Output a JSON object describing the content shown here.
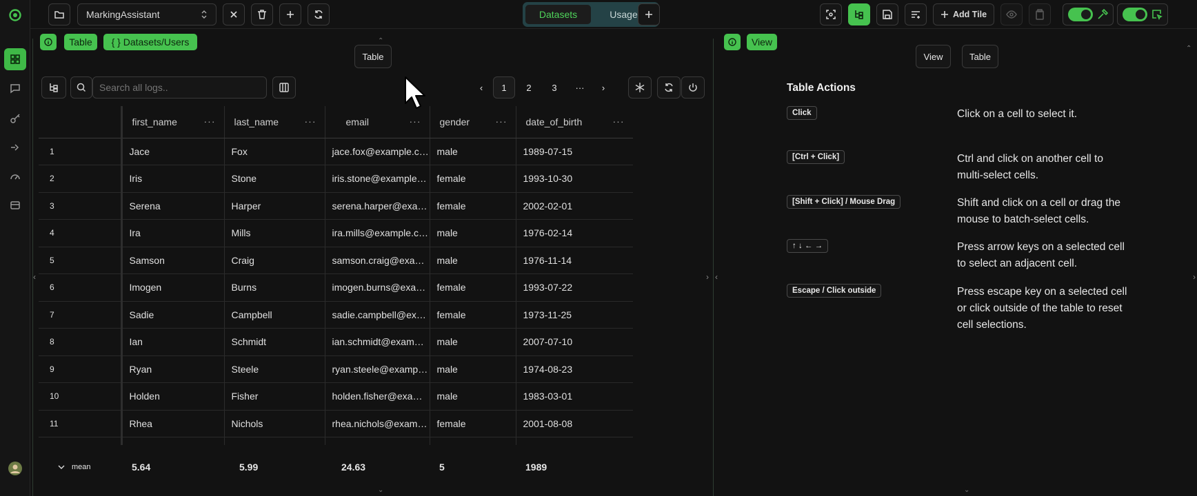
{
  "project": {
    "name": "MarkingAssistant"
  },
  "tabs": [
    "Datasets",
    "Usage"
  ],
  "toolbar": {
    "add_tile": "Add Tile"
  },
  "left_pane": {
    "chip": "Table",
    "path_chip": "{ } Datasets/Users",
    "view_pill": "Table"
  },
  "right_pane": {
    "chip": "View",
    "pills": [
      "View",
      "Table"
    ],
    "title": "Table Actions"
  },
  "search": {
    "placeholder": "Search all logs.."
  },
  "pagination": {
    "pages": [
      "1",
      "2",
      "3"
    ],
    "ellipsis": "···",
    "current": "1"
  },
  "table": {
    "columns": [
      "first_name",
      "last_name",
      "email",
      "gender",
      "date_of_birth"
    ],
    "rows": [
      [
        "1",
        "Jace",
        "Fox",
        "jace.fox@example.com",
        "male",
        "1989-07-15"
      ],
      [
        "2",
        "Iris",
        "Stone",
        "iris.stone@example.com",
        "female",
        "1993-10-30"
      ],
      [
        "3",
        "Serena",
        "Harper",
        "serena.harper@example.com",
        "female",
        "2002-02-01"
      ],
      [
        "4",
        "Ira",
        "Mills",
        "ira.mills@example.com",
        "male",
        "1976-02-14"
      ],
      [
        "5",
        "Samson",
        "Craig",
        "samson.craig@example.com",
        "male",
        "1976-11-14"
      ],
      [
        "6",
        "Imogen",
        "Burns",
        "imogen.burns@example.com",
        "female",
        "1993-07-22"
      ],
      [
        "7",
        "Sadie",
        "Campbell",
        "sadie.campbell@example.com",
        "female",
        "1973-11-25"
      ],
      [
        "8",
        "Ian",
        "Schmidt",
        "ian.schmidt@example.com",
        "male",
        "2007-07-10"
      ],
      [
        "9",
        "Ryan",
        "Steele",
        "ryan.steele@example.com",
        "male",
        "1974-08-23"
      ],
      [
        "10",
        "Holden",
        "Fisher",
        "holden.fisher@example.com",
        "male",
        "1983-03-01"
      ],
      [
        "11",
        "Rhea",
        "Nichols",
        "rhea.nichols@example.com",
        "female",
        "2001-08-08"
      ]
    ],
    "footer": {
      "label": "mean",
      "values": [
        "5.64",
        "5.99",
        "24.63",
        "5",
        "1989"
      ]
    }
  },
  "actions": [
    {
      "key": "Click",
      "description": "Click on a cell to select it."
    },
    {
      "key": "[Ctrl + Click]",
      "description": "Ctrl and click on another cell to multi-select cells."
    },
    {
      "key": "[Shift + Click] / Mouse Drag",
      "description": "Shift and click on a cell or drag the mouse to batch-select cells."
    },
    {
      "key": "↑ ↓ ← →",
      "description": "Press arrow keys on a selected cell to select an adjacent cell."
    },
    {
      "key": "Escape / Click outside",
      "description": "Press escape key on a selected cell or click outside of the table to reset cell selections."
    }
  ],
  "colors": {
    "accent": "#46c24f",
    "background": "#121212",
    "segment": "#244246"
  }
}
